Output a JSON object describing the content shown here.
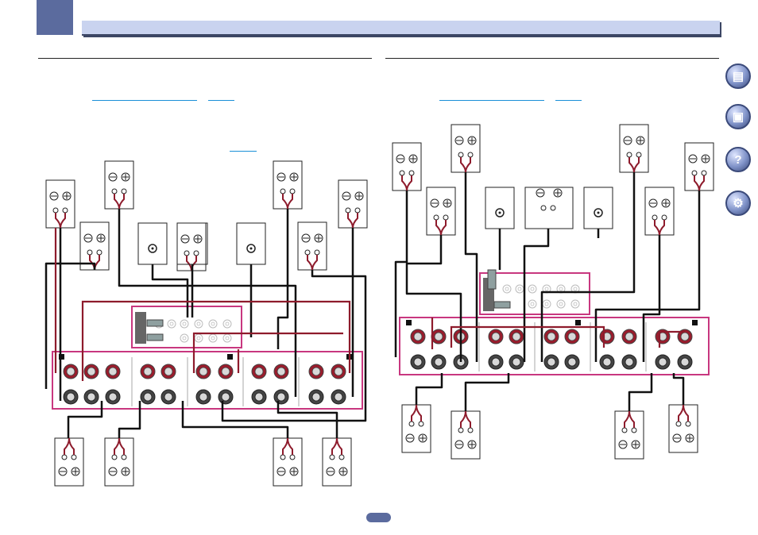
{
  "icons": [
    {
      "name": "book-icon",
      "glyph": "▤"
    },
    {
      "name": "receiver-icon",
      "glyph": "▣"
    },
    {
      "name": "faq-icon",
      "glyph": "?"
    },
    {
      "name": "tools-icon",
      "glyph": "⚙"
    }
  ],
  "colors": {
    "accent": "#5b6b9e",
    "header": "#c9d3ef",
    "terminal_frame": "#c8377f",
    "cable_red": "#8e1b2c",
    "link_blue": "#1a8fd8"
  }
}
